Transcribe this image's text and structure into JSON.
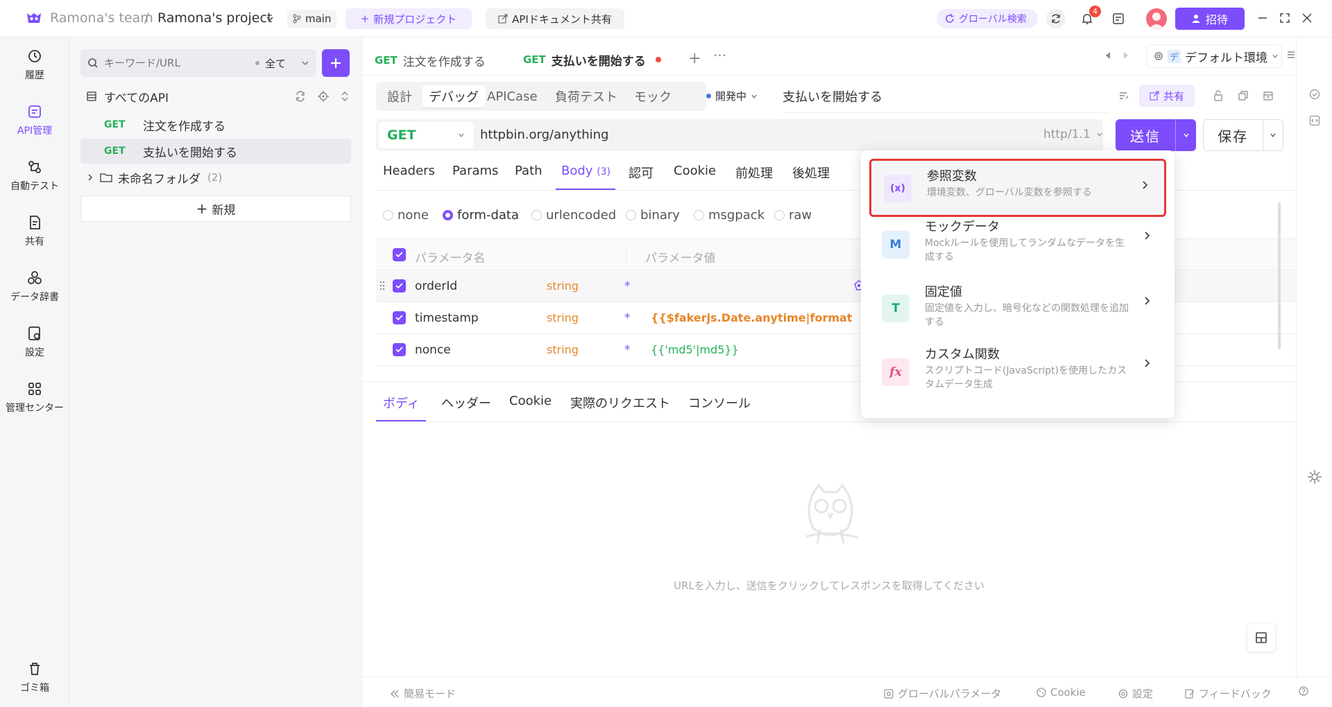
{
  "titlebar": {
    "team": "Ramona's team",
    "separator": "/",
    "project": "Ramona's project",
    "branch": "main",
    "new_project": "新規プロジェクト",
    "share_docs": "APIドキュメント共有",
    "global_search": "グローバル検索",
    "notification_count": "4",
    "invite": "招待"
  },
  "rail": {
    "history": "履歴",
    "api_mgmt": "API管理",
    "auto_test": "自動テスト",
    "share": "共有",
    "data_dict": "データ辞書",
    "settings": "設定",
    "admin_center": "管理センター",
    "trash": "ゴミ箱"
  },
  "sidebar": {
    "search_placeholder": "キーワード/URL",
    "filter": "全て",
    "all_apis": "すべてのAPI",
    "items": [
      {
        "method": "GET",
        "name": "注文を作成する"
      },
      {
        "method": "GET",
        "name": "支払いを開始する"
      }
    ],
    "folder": "未命名フォルダ",
    "folder_count": "(2)",
    "new_label": "新規"
  },
  "tabs": [
    {
      "method": "GET",
      "name": "注文を作成する"
    },
    {
      "method": "GET",
      "name": "支払いを開始する"
    }
  ],
  "env": "デフォルト環境",
  "env_badge": "デ",
  "subtabs": [
    "設計",
    "デバッグ",
    "APICase",
    "負荷テスト",
    "モック"
  ],
  "status": "開発中",
  "api_name": "支払いを開始する",
  "share_label": "共有",
  "request": {
    "method": "GET",
    "url": "httpbin.org/anything",
    "protocol": "http/1.1",
    "send": "送信",
    "save": "保存"
  },
  "req_tabs": [
    "Headers",
    "Params",
    "Path",
    "Body",
    "認可",
    "Cookie",
    "前処理",
    "後処理"
  ],
  "body_count": "(3)",
  "body_types": [
    "none",
    "form-data",
    "urlencoded",
    "binary",
    "msgpack",
    "raw"
  ],
  "params_table": {
    "col_name": "パラメータ名",
    "col_value": "パラメータ値",
    "rows": [
      {
        "name": "orderId",
        "type": "string",
        "req": "*",
        "value": ""
      },
      {
        "name": "timestamp",
        "type": "string",
        "req": "*",
        "value": "{{$fakerjs.Date.anytime|format(YYYY,"
      },
      {
        "name": "nonce",
        "type": "string",
        "req": "*",
        "value": "{{'md5'|md5}}"
      }
    ]
  },
  "resp_tabs": [
    "ボディ",
    "ヘッダー",
    "Cookie",
    "実際のリクエスト",
    "コンソール"
  ],
  "empty_hint": "URLを入力し、送信をクリックしてレスポンスを取得してください",
  "popover": [
    {
      "title": "参照変数",
      "desc": "環境変数、グローバル変数を参照する",
      "icon": "(x)"
    },
    {
      "title": "モックデータ",
      "desc": "Mockルールを使用してランダムなデータを生成する",
      "icon": "M"
    },
    {
      "title": "固定値",
      "desc": "固定値を入力し、暗号化などの関数処理を追加する",
      "icon": "T"
    },
    {
      "title": "カスタム関数",
      "desc": "スクリプトコード(JavaScript)を使用したカスタムデータ生成",
      "icon": "fx"
    }
  ],
  "statusbar": {
    "simple_mode": "簡易モード",
    "global_params": "グローバルパラメータ",
    "cookie": "Cookie",
    "settings": "設定",
    "feedback": "フィードバック"
  },
  "colors": {
    "accent": "#7d4dfc",
    "get": "#26b05a",
    "string": "#e8862a",
    "highlight": "#e53935"
  }
}
